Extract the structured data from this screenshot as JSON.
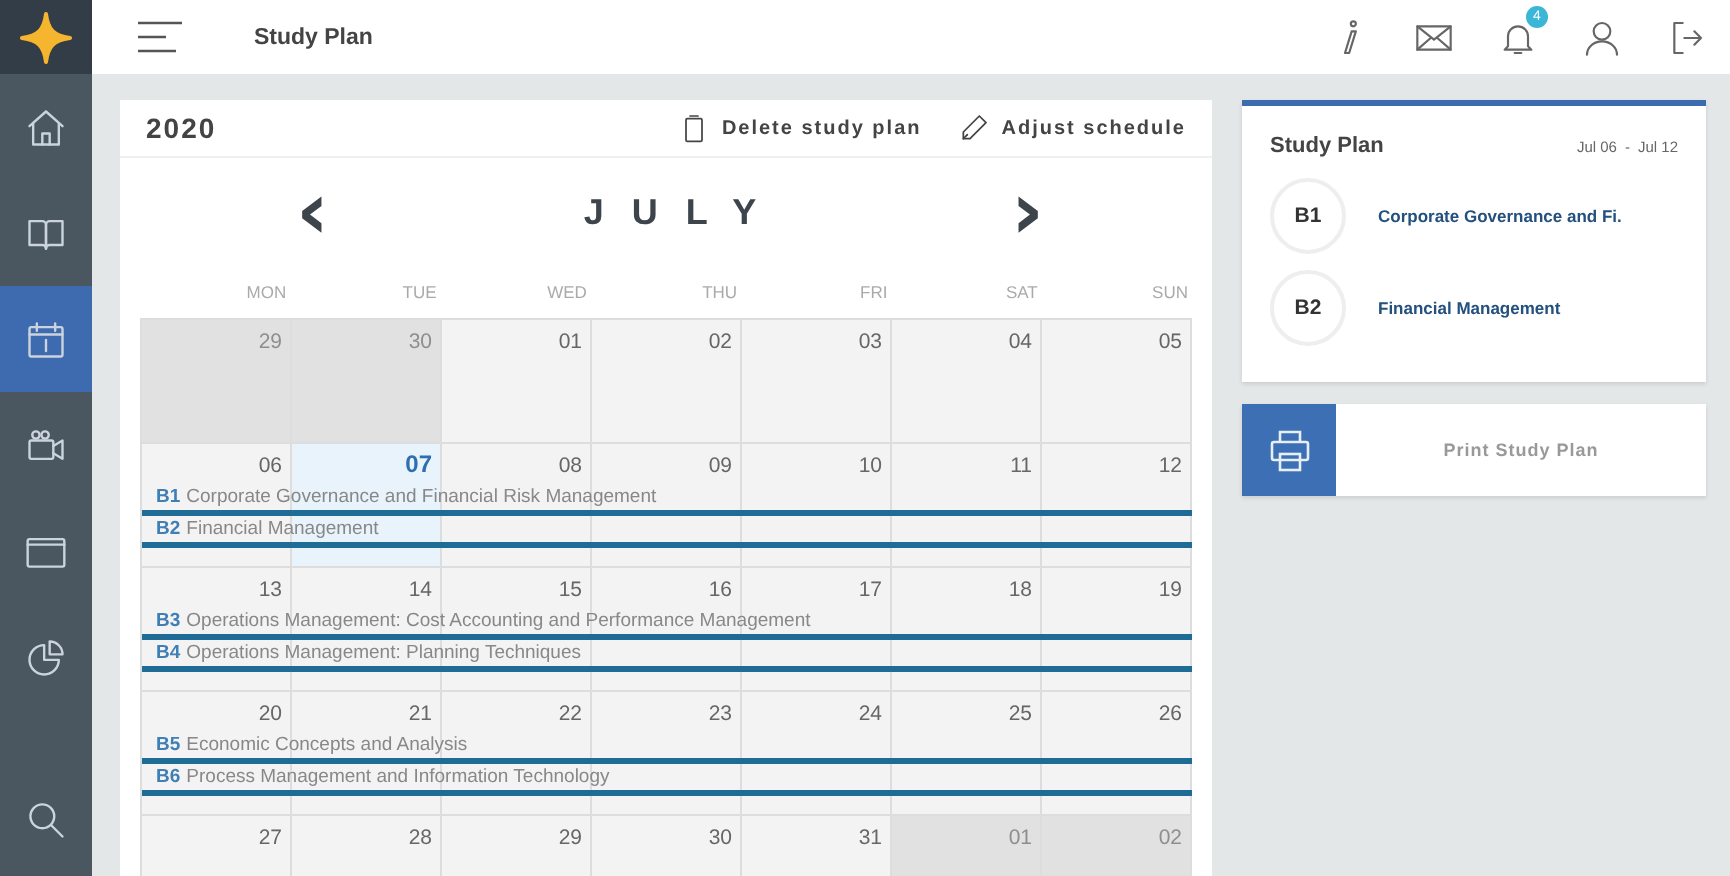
{
  "sidebar": {
    "items": [
      {
        "kind": "home",
        "selected": false
      },
      {
        "kind": "book",
        "selected": false
      },
      {
        "kind": "calendar",
        "selected": true
      },
      {
        "kind": "video",
        "selected": false
      },
      {
        "kind": "window",
        "selected": false
      },
      {
        "kind": "chart",
        "selected": false
      },
      {
        "kind": "search",
        "selected": false
      }
    ]
  },
  "top_bar": {
    "title": "Study Plan",
    "icons": [
      {
        "kind": "info"
      },
      {
        "kind": "mail"
      },
      {
        "kind": "bell",
        "badge": "4"
      },
      {
        "kind": "user"
      },
      {
        "kind": "logout"
      }
    ]
  },
  "calendar": {
    "year": "2020",
    "actions": [
      {
        "kind": "delete",
        "label": "Delete study plan"
      },
      {
        "kind": "edit",
        "label": "Adjust schedule"
      }
    ],
    "prev": "‹",
    "month": "JULY",
    "next": "›",
    "weekdays": [
      "MON",
      "TUE",
      "WED",
      "THU",
      "FRI",
      "SAT",
      "SUN"
    ],
    "weeks": [
      {
        "days": [
          {
            "day": "29",
            "outside": true,
            "today": false
          },
          {
            "day": "30",
            "outside": true,
            "today": false
          },
          {
            "day": "01",
            "outside": false,
            "today": false
          },
          {
            "day": "02",
            "outside": false,
            "today": false
          },
          {
            "day": "03",
            "outside": false,
            "today": false
          },
          {
            "day": "04",
            "outside": false,
            "today": false
          },
          {
            "day": "05",
            "outside": false,
            "today": false
          }
        ]
      },
      {
        "days": [
          {
            "day": "06",
            "outside": false,
            "today": false
          },
          {
            "day": "07",
            "outside": false,
            "today": true
          },
          {
            "day": "08",
            "outside": false,
            "today": false
          },
          {
            "day": "09",
            "outside": false,
            "today": false
          },
          {
            "day": "10",
            "outside": false,
            "today": false
          },
          {
            "day": "11",
            "outside": false,
            "today": false
          },
          {
            "day": "12",
            "outside": false,
            "today": false
          }
        ],
        "events": [
          {
            "code": "B1",
            "title": "Corporate Governance and Financial Risk Management"
          },
          {
            "code": "B2",
            "title": "Financial Management"
          }
        ]
      },
      {
        "days": [
          {
            "day": "13",
            "outside": false,
            "today": false
          },
          {
            "day": "14",
            "outside": false,
            "today": false
          },
          {
            "day": "15",
            "outside": false,
            "today": false
          },
          {
            "day": "16",
            "outside": false,
            "today": false
          },
          {
            "day": "17",
            "outside": false,
            "today": false
          },
          {
            "day": "18",
            "outside": false,
            "today": false
          },
          {
            "day": "19",
            "outside": false,
            "today": false
          }
        ],
        "events": [
          {
            "code": "B3",
            "title": "Operations Management: Cost Accounting and Performance Management"
          },
          {
            "code": "B4",
            "title": "Operations Management: Planning Techniques"
          }
        ]
      },
      {
        "days": [
          {
            "day": "20",
            "outside": false,
            "today": false
          },
          {
            "day": "21",
            "outside": false,
            "today": false
          },
          {
            "day": "22",
            "outside": false,
            "today": false
          },
          {
            "day": "23",
            "outside": false,
            "today": false
          },
          {
            "day": "24",
            "outside": false,
            "today": false
          },
          {
            "day": "25",
            "outside": false,
            "today": false
          },
          {
            "day": "26",
            "outside": false,
            "today": false
          }
        ],
        "events": [
          {
            "code": "B5",
            "title": "Economic Concepts and Analysis"
          },
          {
            "code": "B6",
            "title": "Process Management and Information Technology"
          }
        ]
      },
      {
        "days": [
          {
            "day": "27",
            "outside": false,
            "today": false
          },
          {
            "day": "28",
            "outside": false,
            "today": false
          },
          {
            "day": "29",
            "outside": false,
            "today": false
          },
          {
            "day": "30",
            "outside": false,
            "today": false
          },
          {
            "day": "31",
            "outside": false,
            "today": false
          },
          {
            "day": "01",
            "outside": true,
            "today": false
          },
          {
            "day": "02",
            "outside": true,
            "today": false
          }
        ]
      }
    ]
  },
  "study_plan": {
    "title": "Study Plan",
    "date_from": "Jul 06",
    "separator": "-",
    "date_to": "Jul 12",
    "items": [
      {
        "code": "B1",
        "title": "Corporate Governance and Fi."
      },
      {
        "code": "B2",
        "title": "Financial Management"
      }
    ]
  },
  "print_button": {
    "label": "Print Study Plan"
  }
}
